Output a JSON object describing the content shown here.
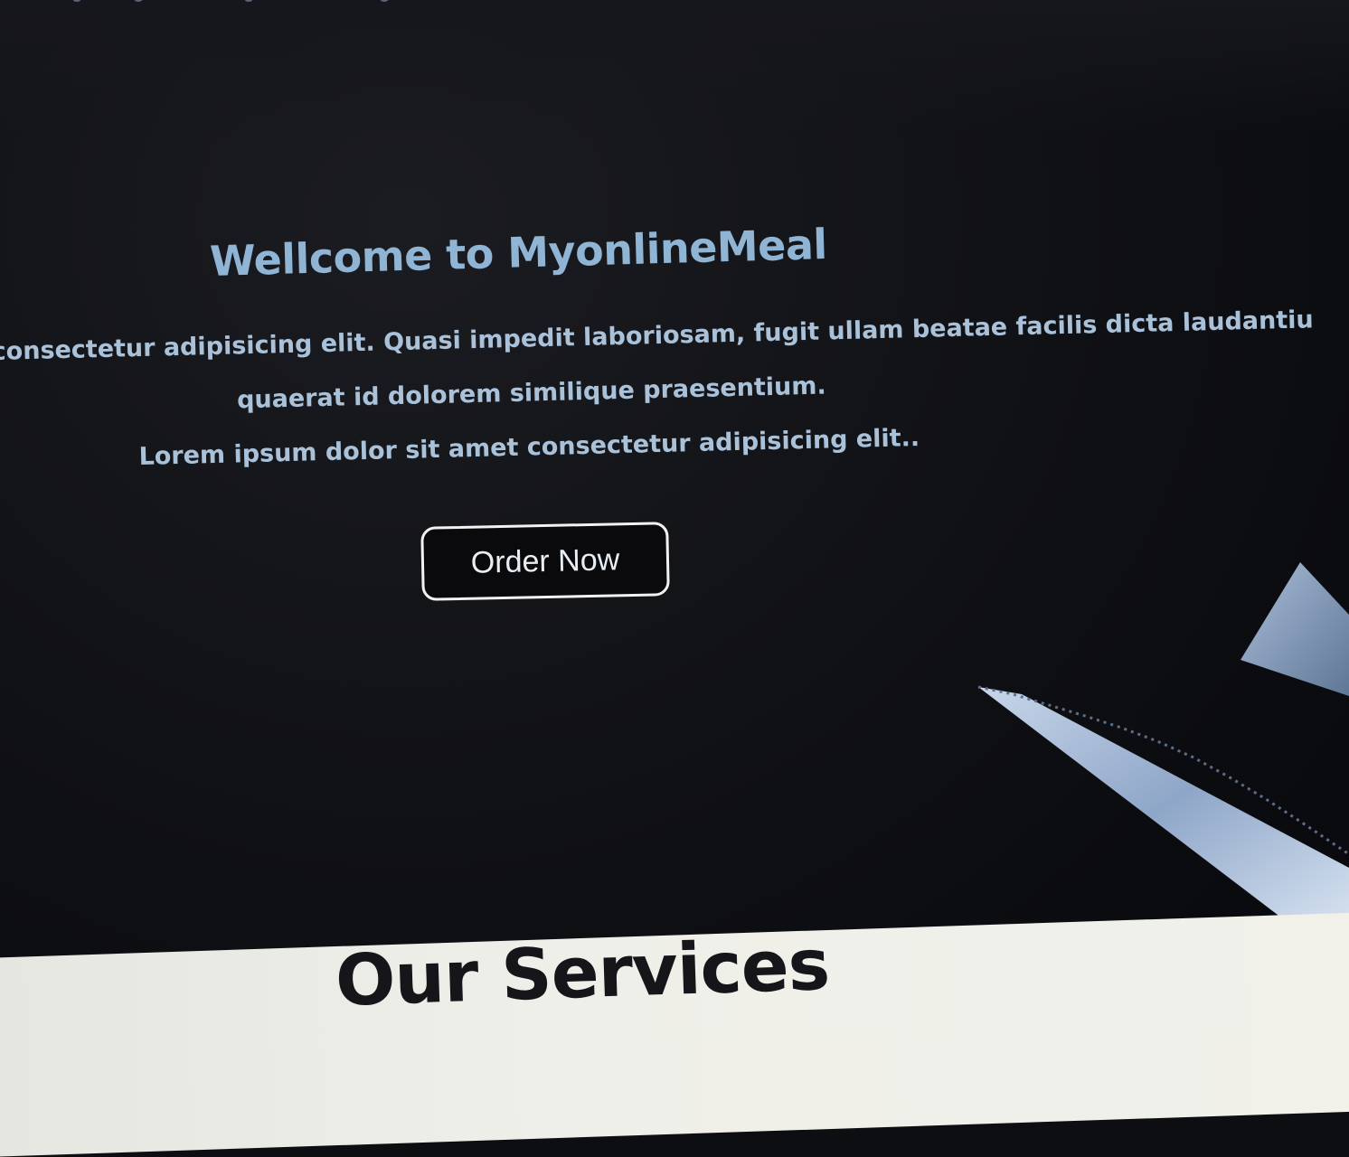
{
  "hero": {
    "title": "Wellcome to MyonlineMeal",
    "text_line1": "consectetur adipisicing elit. Quasi impedit laboriosam, fugit ullam beatae facilis dicta laudantiu",
    "text_line2": "quaerat id dolorem similique praesentium.",
    "text_line3": "Lorem ipsum dolor sit amet consectetur adipisicing elit..",
    "order_button_label": "Order Now",
    "decoration_icon": "knife-icon"
  },
  "services": {
    "title": "Our Services"
  },
  "colors": {
    "hero_background": "#0d0e12",
    "hero_title": "#8fb4d4",
    "hero_text": "#a9c2da",
    "button_border": "#f2f2f2",
    "services_background": "#efefe9",
    "services_title": "#15151a"
  }
}
